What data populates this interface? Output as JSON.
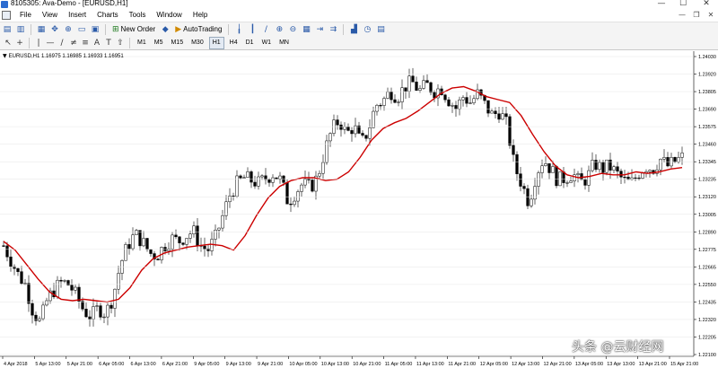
{
  "window": {
    "title": "8105305: Ava-Demo - [EURUSD,H1]",
    "controls": [
      "—",
      "☐",
      "✕"
    ],
    "mdi_controls": [
      "—",
      "❐",
      "✕"
    ]
  },
  "menu": [
    "File",
    "View",
    "Insert",
    "Charts",
    "Tools",
    "Window",
    "Help"
  ],
  "toolbar": {
    "new_order_label": "New Order",
    "autotrading_label": "AutoTrading"
  },
  "timeframes": [
    "M1",
    "M5",
    "M15",
    "M30",
    "H1",
    "H4",
    "D1",
    "W1",
    "MN"
  ],
  "active_timeframe": "H1",
  "chart_header": "EURUSD,H1  1.16975 1.16985 1.16933 1.16951",
  "watermark": "头条 @云财经网",
  "colors": {
    "candle": "#000000",
    "ma_line": "#cc0000",
    "grid": "#e6e6e6"
  },
  "chart_data": {
    "type": "candlestick",
    "symbol": "EURUSD",
    "timeframe": "H1",
    "ylim": [
      1.2201,
      1.2407
    ],
    "y_ticks": [
      "1.24030",
      "1.23920",
      "1.23805",
      "1.23690",
      "1.23575",
      "1.23460",
      "1.23345",
      "1.23235",
      "1.23120",
      "1.23005",
      "1.22890",
      "1.22775",
      "1.22665",
      "1.22550",
      "1.22435",
      "1.22320",
      "1.22205",
      "1.22100"
    ],
    "x_ticks": [
      "4 Apr 2018",
      "5 Apr 13:00",
      "5 Apr 21:00",
      "6 Apr 05:00",
      "6 Apr 13:00",
      "6 Apr 21:00",
      "9 Apr 05:00",
      "9 Apr 13:00",
      "9 Apr 21:00",
      "10 Apr 05:00",
      "10 Apr 13:00",
      "10 Apr 21:00",
      "11 Apr 05:00",
      "11 Apr 13:00",
      "11 Apr 21:00",
      "12 Apr 05:00",
      "12 Apr 13:00",
      "12 Apr 21:00",
      "13 Apr 05:00",
      "13 Apr 13:00",
      "13 Apr 21:00",
      "15 Apr 21:00"
    ],
    "close_path": [
      1.2275,
      1.2265,
      1.2255,
      1.2248,
      1.223,
      1.2222,
      1.2238,
      1.2245,
      1.225,
      1.2248,
      1.224,
      1.223,
      1.2226,
      1.2232,
      1.2228,
      1.224,
      1.2262,
      1.2275,
      1.2283,
      1.2278,
      1.227,
      1.2268,
      1.2275,
      1.228,
      1.2278,
      1.2282,
      1.2285,
      1.2275,
      1.2272,
      1.228,
      1.2295,
      1.231,
      1.2318,
      1.2322,
      1.232,
      1.2318,
      1.2322,
      1.2325,
      1.232,
      1.2305,
      1.2312,
      1.2318,
      1.2315,
      1.2322,
      1.234,
      1.2355,
      1.2362,
      1.2352,
      1.2358,
      1.2345,
      1.2355,
      1.2372,
      1.2375,
      1.2382,
      1.2378,
      1.2385,
      1.2388,
      1.2382,
      1.2386,
      1.2382,
      1.2384,
      1.2376,
      1.237,
      1.2378,
      1.2374,
      1.238,
      1.2372,
      1.2365,
      1.2368,
      1.2358,
      1.233,
      1.2318,
      1.2305,
      1.2325,
      1.2335,
      1.2328,
      1.232,
      1.2322,
      1.2325,
      1.2318,
      1.2322,
      1.2332,
      1.2328,
      1.233,
      1.2325,
      1.232,
      1.2318,
      1.2325,
      1.233,
      1.2328,
      1.2335,
      1.233,
      1.2333,
      1.2336
    ],
    "ma_path": [
      1.2278,
      1.2272,
      1.2262,
      1.2252,
      1.2243,
      1.2238,
      1.2237,
      1.2238,
      1.2237,
      1.2236,
      1.2238,
      1.2246,
      1.2258,
      1.2266,
      1.227,
      1.2272,
      1.2274,
      1.2275,
      1.2276,
      1.2275,
      1.2272,
      1.2282,
      1.2296,
      1.2308,
      1.2316,
      1.232,
      1.2322,
      1.2322,
      1.232,
      1.2321,
      1.2326,
      1.2336,
      1.2348,
      1.2356,
      1.236,
      1.2363,
      1.2368,
      1.2374,
      1.238,
      1.2384,
      1.2385,
      1.2382,
      1.2378,
      1.2376,
      1.2374,
      1.2365,
      1.2352,
      1.234,
      1.233,
      1.2324,
      1.2322,
      1.2323,
      1.2325,
      1.2324,
      1.2324,
      1.2326,
      1.2325,
      1.2326,
      1.2328,
      1.2329
    ]
  }
}
